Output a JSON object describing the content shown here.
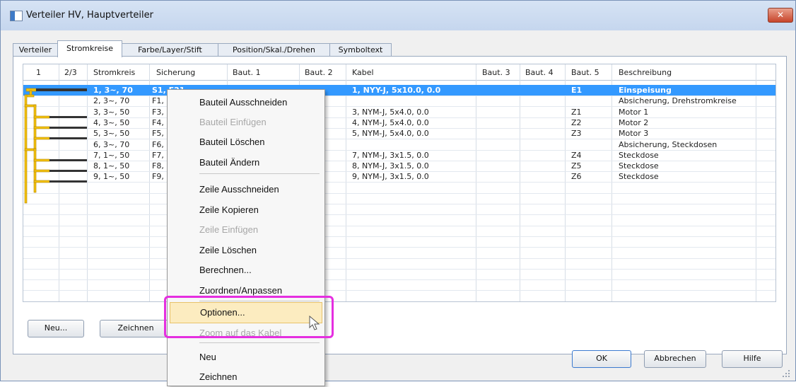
{
  "window": {
    "title": "Verteiler HV, Hauptverteiler",
    "close_label": "✕",
    "accent": "#3399ff"
  },
  "tabs": [
    "Verteiler",
    "Stromkreise",
    "Farbe/Layer/Stift",
    "Position/Skal./Drehen",
    "Symboltext"
  ],
  "active_tab": "Stromkreise",
  "grid": {
    "columns": [
      "1",
      "2/3",
      "Stromkreis",
      "Sicherung",
      "Baut. 1",
      "Baut. 2",
      "Kabel",
      "Baut. 3",
      "Baut. 4",
      "Baut. 5",
      "Beschreibung"
    ],
    "rows": [
      {
        "stromkreis": "1, 3~, 70",
        "sicherung": "S1, F21",
        "kabel": "1, NYY-J, 5x10.0, 0.0",
        "baut5": "E1",
        "beschreibung": "Einspeisung",
        "selected": true
      },
      {
        "stromkreis": "2, 3~, 70",
        "sicherung": "F1, (",
        "kabel": "",
        "baut5": "",
        "beschreibung": "Absicherung, Drehstromkreise"
      },
      {
        "stromkreis": "3, 3~, 50",
        "sicherung": "F3,",
        "kabel": "3, NYM-J, 5x4.0, 0.0",
        "baut5": "Z1",
        "beschreibung": "Motor 1"
      },
      {
        "stromkreis": "4, 3~, 50",
        "sicherung": "F4,",
        "kabel": "4, NYM-J, 5x4.0, 0.0",
        "baut5": "Z2",
        "beschreibung": "Motor 2"
      },
      {
        "stromkreis": "5, 3~, 50",
        "sicherung": "F5,",
        "kabel": "5, NYM-J, 5x4.0, 0.0",
        "baut5": "Z3",
        "beschreibung": "Motor 3"
      },
      {
        "stromkreis": "6, 3~, 70",
        "sicherung": "F6, (",
        "kabel": "",
        "baut5": "",
        "beschreibung": "Absicherung, Steckdosen"
      },
      {
        "stromkreis": "7, 1~, 50",
        "sicherung": "F7,",
        "kabel": "7, NYM-J, 3x1.5, 0.0",
        "baut5": "Z4",
        "beschreibung": "Steckdose"
      },
      {
        "stromkreis": "8, 1~, 50",
        "sicherung": "F8,",
        "kabel": "8, NYM-J, 3x1.5, 0.0",
        "baut5": "Z5",
        "beschreibung": "Steckdose"
      },
      {
        "stromkreis": "9, 1~, 50",
        "sicherung": "F9,",
        "kabel": "9, NYM-J, 3x1.5, 0.0",
        "baut5": "Z6",
        "beschreibung": "Steckdose"
      }
    ]
  },
  "buttons": {
    "neu": "Neu...",
    "zeichnen": "Zeichnen",
    "ok": "OK",
    "abbrechen": "Abbrechen",
    "hilfe": "Hilfe"
  },
  "context_menu": {
    "items": [
      {
        "label": "Bauteil Ausschneiden",
        "disabled": false
      },
      {
        "label": "Bauteil Einfügen",
        "disabled": true
      },
      {
        "label": "Bauteil Löschen",
        "disabled": false
      },
      {
        "label": "Bauteil Ändern",
        "disabled": false
      },
      {
        "label": "Zeile Ausschneiden",
        "disabled": false
      },
      {
        "label": "Zeile Kopieren",
        "disabled": false
      },
      {
        "label": "Zeile Einfügen",
        "disabled": true
      },
      {
        "label": "Zeile Löschen",
        "disabled": false
      },
      {
        "label": "Berechnen...",
        "disabled": false
      },
      {
        "label": "Zuordnen/Anpassen",
        "disabled": false
      },
      {
        "label": "Optionen...",
        "disabled": false,
        "hover": true
      },
      {
        "label": "Zoom auf das Kabel",
        "disabled": true
      },
      {
        "label": "Neu",
        "disabled": false
      },
      {
        "label": "Zeichnen",
        "disabled": false
      }
    ],
    "highlight_color": "#e52fe0"
  }
}
